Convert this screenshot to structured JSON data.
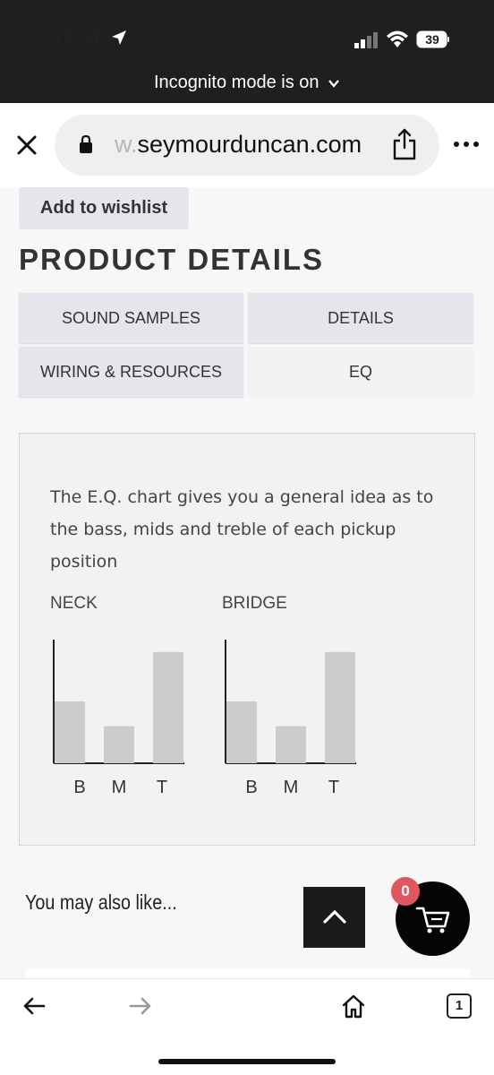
{
  "status_bar": {
    "time": "13:37",
    "battery": "39"
  },
  "browser": {
    "incognito_text": "Incognito mode is on",
    "url_faded": "w.",
    "url_main": "seymourduncan.com"
  },
  "product": {
    "wishlist_label": "Add to wishlist",
    "section_title": "PRODUCT DETAILS",
    "tabs": [
      {
        "label": "SOUND SAMPLES",
        "active": false
      },
      {
        "label": "DETAILS",
        "active": false
      },
      {
        "label": "WIRING & RESOURCES",
        "active": false
      },
      {
        "label": "EQ",
        "active": true
      }
    ],
    "eq_description": "The E.Q. chart gives you a general idea as to the bass, mids and treble of each pickup position"
  },
  "chart_data": [
    {
      "type": "bar",
      "title": "NECK",
      "categories": [
        "B",
        "M",
        "T"
      ],
      "values": [
        5,
        3,
        9
      ],
      "ylim": [
        0,
        10
      ],
      "color": "#cccccc"
    },
    {
      "type": "bar",
      "title": "BRIDGE",
      "categories": [
        "B",
        "M",
        "T"
      ],
      "values": [
        5,
        3,
        9
      ],
      "ylim": [
        0,
        10
      ],
      "color": "#cccccc"
    }
  ],
  "recommendations": {
    "heading": "You may also like..."
  },
  "cart": {
    "count": "0",
    "badge_color": "#e0575f"
  },
  "toolbar": {
    "tab_count": "1"
  }
}
